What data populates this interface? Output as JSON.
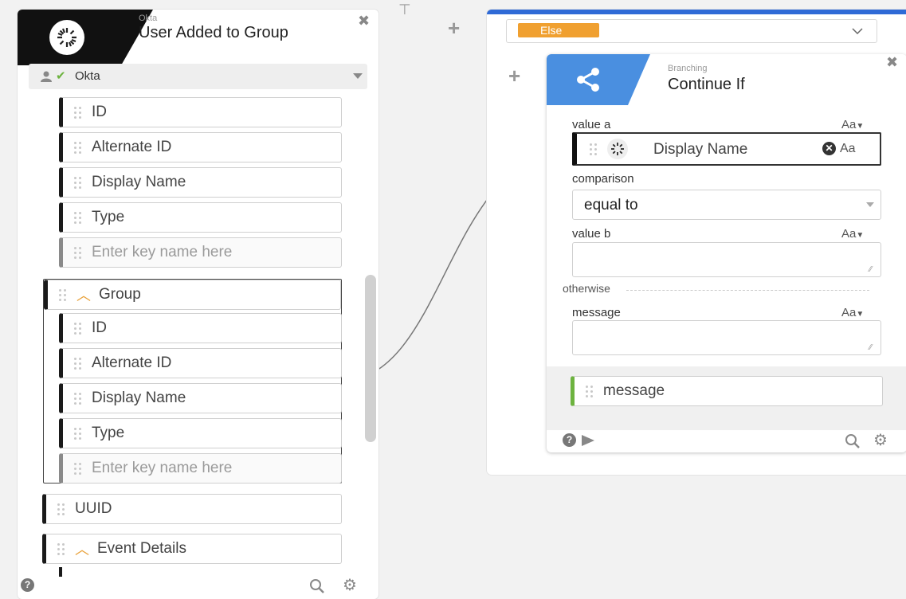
{
  "left_card": {
    "app": "Okta",
    "title": "User Added to Group",
    "connection": "Okta",
    "fields_top": [
      {
        "label": "ID"
      },
      {
        "label": "Alternate ID"
      },
      {
        "label": "Display Name"
      },
      {
        "label": "Type"
      },
      {
        "label": "Enter key name here",
        "placeholder": true
      }
    ],
    "group": {
      "label": "Group",
      "fields": [
        {
          "label": "ID"
        },
        {
          "label": "Alternate ID"
        },
        {
          "label": "Display Name"
        },
        {
          "label": "Type"
        },
        {
          "label": "Enter key name here",
          "placeholder": true
        }
      ]
    },
    "uuid_label": "UUID",
    "event_details_label": "Event Details"
  },
  "right_panel": {
    "else_label": "Else"
  },
  "inner_card": {
    "category": "Branching",
    "title": "Continue If",
    "value_a_label": "value a",
    "value_a_chip": "Display Name",
    "type_toggle": "Aa",
    "comparison_label": "comparison",
    "comparison_value": "equal to",
    "value_b_label": "value b",
    "otherwise_label": "otherwise",
    "message_label": "message",
    "output_label": "message"
  },
  "colors": {
    "accent_blue": "#2f6ad6",
    "branch_blue": "#4a8fe0",
    "else_orange": "#f0a030",
    "okta_black": "#111111",
    "output_green": "#6db33f",
    "chevron_orange": "#e9a23b"
  }
}
